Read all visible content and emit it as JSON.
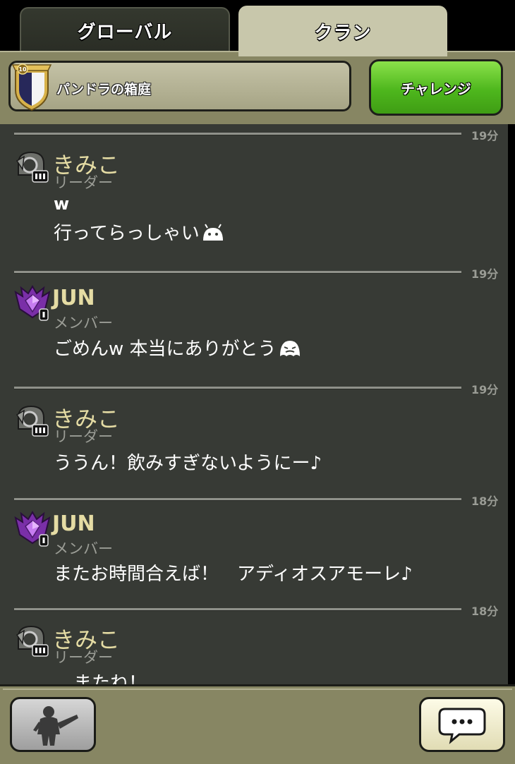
{
  "tabs": {
    "global_label": "グローバル",
    "clan_label": "クラン"
  },
  "clan": {
    "level": "10",
    "name": "パンドラの箱庭",
    "challenge_label": "チャレンジ"
  },
  "messages": [
    {
      "time": "19分",
      "name": "きみこ",
      "role": "リーダー",
      "rank": "leader-badge",
      "lines": [
        "w",
        "行ってらっしゃい"
      ],
      "emoji": "android-emoji"
    },
    {
      "time": "19分",
      "name": "JUN",
      "role": "メンバー",
      "rank": "member-badge",
      "lines": [
        "ごめんw 本当にありがとう"
      ],
      "emoji": "ghost-emoji"
    },
    {
      "time": "19分",
      "name": "きみこ",
      "role": "リーダー",
      "rank": "leader-badge",
      "lines": [
        "ううん！飲みすぎないようにー♪"
      ]
    },
    {
      "time": "18分",
      "name": "JUN",
      "role": "メンバー",
      "rank": "member-badge",
      "lines": [
        "またお時間合えば！　アディオスアモーレ♪"
      ]
    },
    {
      "time": "18分",
      "name": "きみこ",
      "role": "リーダー",
      "rank": "leader-badge",
      "lines": [
        "またね！"
      ]
    }
  ],
  "colors": {
    "chat_bg": "#373a35",
    "name_color": "#e5dca4",
    "panel_color": "#878663",
    "challenge_green": "#4eb71d"
  },
  "icons": {
    "army": "warrior-silhouette-icon",
    "chat": "speech-bubble-icon"
  }
}
